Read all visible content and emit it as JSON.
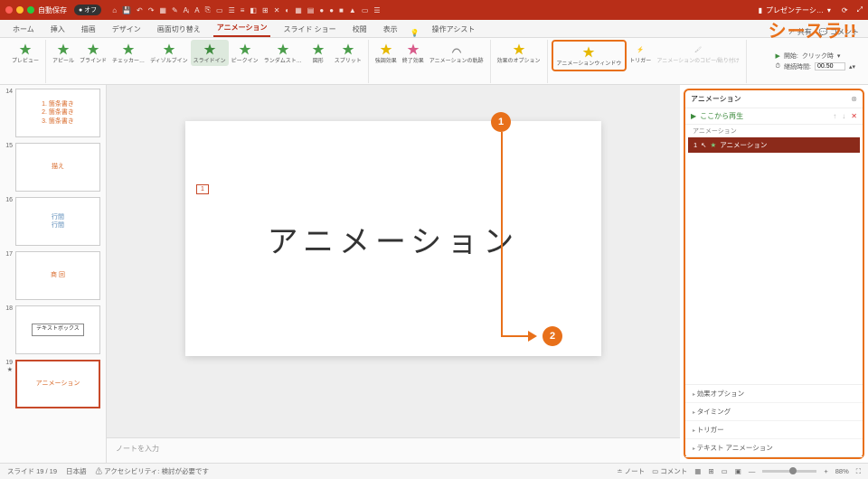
{
  "watermark": "シースラ!!",
  "titlebar": {
    "autosave": "自動保存",
    "off": "● オフ",
    "filename": "プレゼンテーシ…"
  },
  "tabs": {
    "items": [
      "ホーム",
      "挿入",
      "描画",
      "デザイン",
      "画面切り替え",
      "アニメーション",
      "スライド ショー",
      "校閲",
      "表示"
    ],
    "active": 5,
    "assist": "操作アシスト",
    "share": "共有",
    "comment": "コメント"
  },
  "ribbon": {
    "preview": "プレビュー",
    "effects": [
      {
        "label": "アピール"
      },
      {
        "label": "ブラインド"
      },
      {
        "label": "チェッカー…"
      },
      {
        "label": "ディゾルブイン"
      },
      {
        "label": "スライドイン",
        "active": true
      },
      {
        "label": "ピークイン"
      },
      {
        "label": "ランダムスト…"
      },
      {
        "label": "図形"
      },
      {
        "label": "スプリット"
      }
    ],
    "emph": "強調効果",
    "exit": "終了効果",
    "motion": "アニメーションの軌跡",
    "effopt": "効果のオプション",
    "animwin": "アニメーションウィンドウ",
    "trigger": "トリガー",
    "copy": "アニメーションのコピー/貼り付け",
    "start_label": "開始:",
    "start_val": "クリック時",
    "dur_label": "継続時間:",
    "dur_val": "00.50"
  },
  "thumbs": [
    {
      "num": "14",
      "lines": [
        "1. 箇条書き",
        "2. 箇条書き",
        "3. 箇条書き"
      ],
      "cls": ""
    },
    {
      "num": "15",
      "lines": [
        "描え"
      ],
      "cls": ""
    },
    {
      "num": "16",
      "lines": [
        "行間",
        "行間"
      ],
      "cls": "blue"
    },
    {
      "num": "17",
      "lines": [
        "商 回"
      ],
      "cls": ""
    },
    {
      "num": "18",
      "lines": [
        "テキストボックス"
      ],
      "cls": "box"
    },
    {
      "num": "19",
      "lines": [
        "アニメーション"
      ],
      "cls": "",
      "active": true,
      "star": true
    }
  ],
  "slide": {
    "tag": "1",
    "text": "アニメーション"
  },
  "notes": "ノートを入力",
  "panel": {
    "title": "アニメーション",
    "play": "ここから再生",
    "sub": "アニメーション",
    "item": {
      "idx": "1",
      "label": "アニメーション"
    },
    "opts": [
      "効果オプション",
      "タイミング",
      "トリガー",
      "テキスト アニメーション"
    ]
  },
  "status": {
    "slide": "スライド 19 / 19",
    "lang": "日本語",
    "access": "アクセシビリティ: 検討が必要です",
    "notes": "ノート",
    "comments": "コメント",
    "zoom": "88%"
  },
  "callouts": {
    "c1": "1",
    "c2": "2"
  }
}
